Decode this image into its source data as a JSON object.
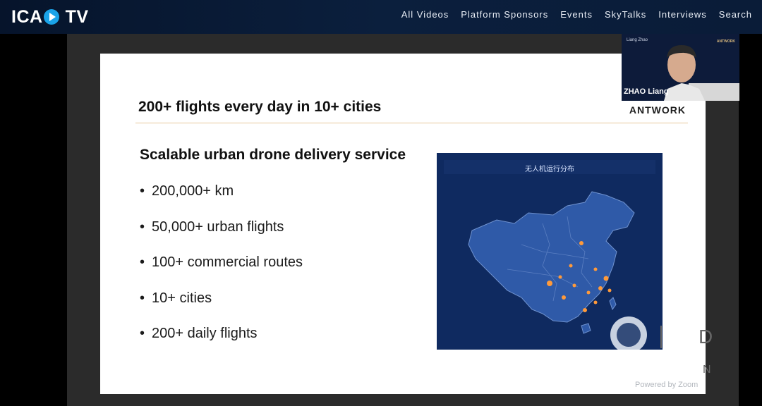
{
  "site": {
    "logo_left": "ICA",
    "logo_right": "TV"
  },
  "nav": {
    "items": [
      "All Videos",
      "Platform Sponsors",
      "Events",
      "SkyTalks",
      "Interviews",
      "Search"
    ]
  },
  "slide": {
    "title": "200+ flights every day in 10+ cities",
    "brand": "ANTWORK",
    "subheading": "Scalable urban drone delivery service",
    "bullets": [
      "200,000+ km",
      "50,000+ urban flights",
      "100+ commercial routes",
      "10+ cities",
      "200+ daily flights"
    ],
    "map_title": "无人机运行分布"
  },
  "speaker": {
    "name": "ZHAO Liang",
    "small_name": "Liang Zhao",
    "small_brand": "ANTWORK"
  },
  "footer": {
    "powered_by": "Powered by Zoom",
    "partial_right_1": "D",
    "partial_right_2": "N"
  },
  "colors": {
    "topbar": "#0b1f3d",
    "accent": "#1aa3e8",
    "map_bg": "#0f2a60",
    "title_line": "#e6c79b"
  }
}
